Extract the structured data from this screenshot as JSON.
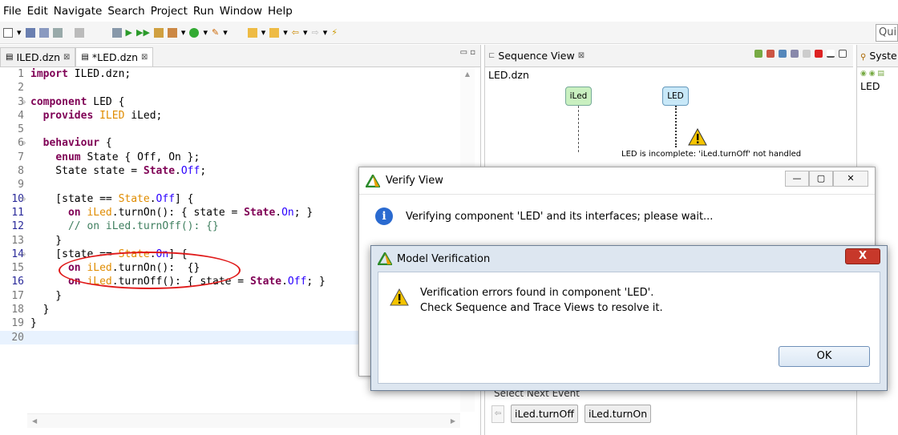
{
  "menu": [
    "File",
    "Edit",
    "Navigate",
    "Search",
    "Project",
    "Run",
    "Window",
    "Help"
  ],
  "quick_access": "Qui",
  "editor": {
    "tabs": [
      {
        "label": "ILED.dzn",
        "close": "⊠"
      },
      {
        "label": "*LED.dzn",
        "close": "⊠"
      }
    ]
  },
  "code": [
    {
      "n": "1",
      "html": "<span class='kw'>import</span> ILED.dzn;"
    },
    {
      "n": "2",
      "html": ""
    },
    {
      "n": "3",
      "fold": true,
      "html": "<span class='kw'>component</span> LED {"
    },
    {
      "n": "4",
      "html": "  <span class='kw'>provides</span> <span class='ty'>ILED</span> iLed;"
    },
    {
      "n": "5",
      "html": ""
    },
    {
      "n": "6",
      "fold": true,
      "html": "  <span class='kw'>behaviour</span> {"
    },
    {
      "n": "7",
      "html": "    <span class='kw'>enum</span> State { Off, On };"
    },
    {
      "n": "8",
      "html": "    State state = <span class='kw'>State</span>.<span class='st'>Off</span>;"
    },
    {
      "n": "9",
      "html": ""
    },
    {
      "n": "10",
      "fold": true,
      "mark": true,
      "html": "    [state == <span class='ty'>State</span>.<span class='st'>Off</span>] {"
    },
    {
      "n": "11",
      "mark": true,
      "html": "      <span class='kw'>on</span> <span class='ty'>iLed</span>.turnOn(): { state = <span class='kw'>State</span>.<span class='st'>On</span>; }"
    },
    {
      "n": "12",
      "mark": true,
      "html": "      <span class='cm'>// on iLed.turnOff(): {}</span>"
    },
    {
      "n": "13",
      "html": "    }"
    },
    {
      "n": "14",
      "fold": true,
      "mark": true,
      "html": "    [state == <span class='ty'>State</span>.<span class='st'>On</span>] {"
    },
    {
      "n": "15",
      "html": "      <span class='kw'>on</span> <span class='ty'>iLed</span>.turnOn():  {}"
    },
    {
      "n": "16",
      "mark": true,
      "html": "      <span class='kw'>on</span> <span class='ty'>iLed</span>.turnOff(): { state = <span class='kw'>State</span>.<span class='st'>Off</span>; }"
    },
    {
      "n": "17",
      "html": "    }"
    },
    {
      "n": "18",
      "html": "  }"
    },
    {
      "n": "19",
      "html": "}"
    },
    {
      "n": "20",
      "cur": true,
      "html": ""
    }
  ],
  "sequence": {
    "title": "Sequence View",
    "close": "⊠",
    "file": "LED.dzn",
    "lifelines": [
      "iLed",
      "LED"
    ],
    "warning": "LED is incomplete: 'iLed.turnOff' not handled",
    "select_event": "Select Next Event",
    "events": [
      "iLed.turnOff",
      "iLed.turnOn"
    ]
  },
  "system": {
    "title": "Syste",
    "file": "LED"
  },
  "verify": {
    "title": "Verify View",
    "message": "Verifying component 'LED' and its interfaces; please wait..."
  },
  "model": {
    "title": "Model Verification",
    "close": "X",
    "line1": "Verification errors found in component 'LED'.",
    "line2": "Check Sequence and Trace Views to resolve it.",
    "ok": "OK"
  },
  "colors": {
    "accent": "#2a6ad0",
    "error": "#e01a1a",
    "keyword": "#7f0055"
  }
}
